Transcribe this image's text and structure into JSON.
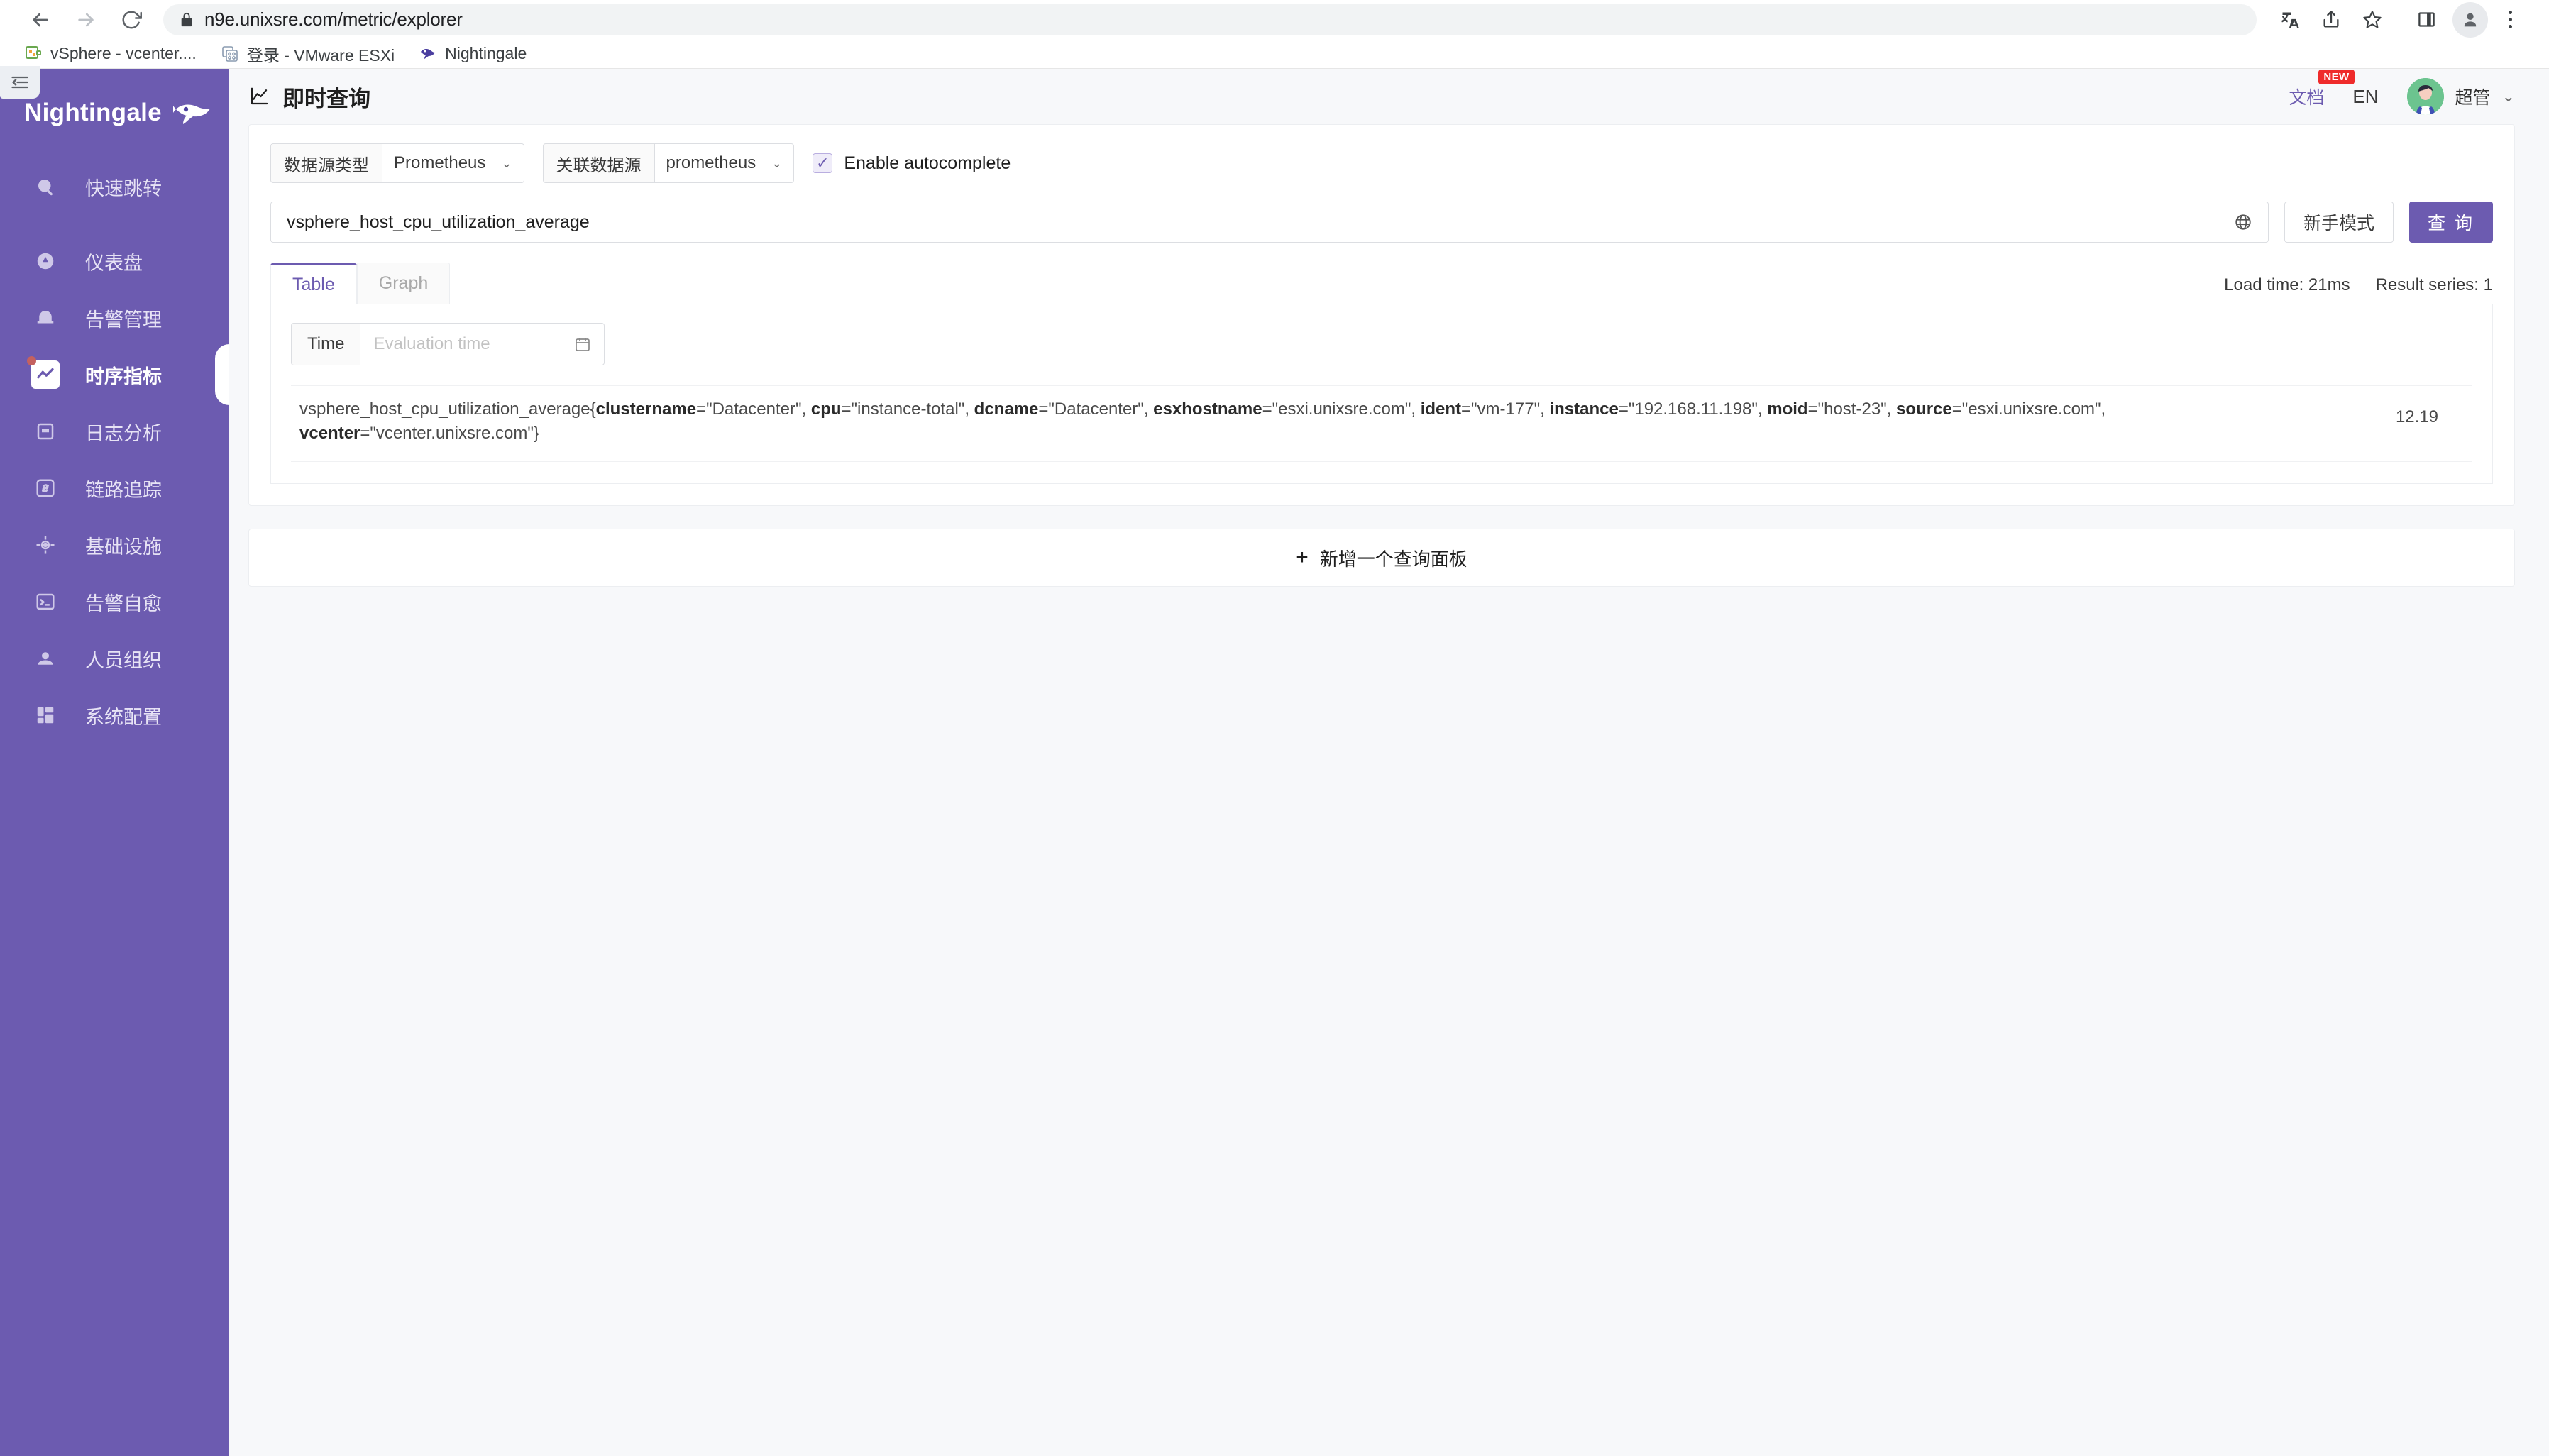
{
  "browser": {
    "url": "n9e.unixsre.com/metric/explorer",
    "nav": {
      "back": "back-arrow",
      "forward": "forward-arrow",
      "reload": "reload"
    },
    "lock_icon": "lock-icon",
    "bookmarks": [
      {
        "label": "vSphere - vcenter....",
        "icon": "vsphere-icon"
      },
      {
        "label": "登录 - VMware ESXi",
        "icon": "esxi-icon"
      },
      {
        "label": "Nightingale",
        "icon": "nightingale-icon"
      }
    ],
    "actions": [
      "translate-icon",
      "share-icon",
      "bookmark-star-icon",
      "side-panel-icon",
      "profile-icon",
      "more-menu-icon"
    ]
  },
  "sidebar": {
    "brand": "Nightingale",
    "collapse_icon": "collapse-sidebar-icon",
    "search_item": {
      "label": "快速跳转",
      "icon": "search-icon"
    },
    "items": [
      {
        "label": "仪表盘",
        "icon": "dashboard-icon",
        "active": false
      },
      {
        "label": "告警管理",
        "icon": "alert-bell-icon",
        "active": false
      },
      {
        "label": "时序指标",
        "icon": "metrics-chart-icon",
        "active": true
      },
      {
        "label": "日志分析",
        "icon": "log-analysis-icon",
        "active": false
      },
      {
        "label": "链路追踪",
        "icon": "trace-link-icon",
        "active": false
      },
      {
        "label": "基础设施",
        "icon": "infrastructure-icon",
        "active": false
      },
      {
        "label": "告警自愈",
        "icon": "terminal-icon",
        "active": false
      },
      {
        "label": "人员组织",
        "icon": "user-org-icon",
        "active": false
      },
      {
        "label": "系统配置",
        "icon": "system-settings-icon",
        "active": false
      }
    ]
  },
  "topbar": {
    "title": "即时查询",
    "title_icon": "line-chart-icon",
    "doc_label": "文档",
    "doc_badge": "NEW",
    "lang_label": "EN",
    "user_name": "超管",
    "caret_icon": "chevron-down-icon",
    "avatar_icon": "user-avatar"
  },
  "query_form": {
    "datasource_type": {
      "addon": "数据源类型",
      "value": "Prometheus"
    },
    "datasource": {
      "addon": "关联数据源",
      "value": "prometheus"
    },
    "autocomplete": {
      "label": "Enable autocomplete",
      "checked": "✓"
    },
    "promql": "vsphere_host_cpu_utilization_average",
    "globe_icon": "globe-icon",
    "beginner_mode_label": "新手模式",
    "query_button_label": "查 询"
  },
  "results": {
    "tabs": [
      {
        "label": "Table",
        "active": true
      },
      {
        "label": "Graph",
        "active": false
      }
    ],
    "load_time": "Load time: 21ms",
    "result_series": "Result series: 1",
    "time_addon": "Time",
    "time_placeholder": "Evaluation time",
    "calendar_icon": "calendar-icon",
    "rows": [
      {
        "metric": "vsphere_host_cpu_utilization_average",
        "open_brace": "{",
        "close_brace": "}",
        "labels": [
          {
            "name": "clustername",
            "value": "\"Datacenter\""
          },
          {
            "name": "cpu",
            "value": "\"instance-total\""
          },
          {
            "name": "dcname",
            "value": "\"Datacenter\""
          },
          {
            "name": "esxhostname",
            "value": "\"esxi.unixsre.com\""
          },
          {
            "name": "ident",
            "value": "\"vm-177\""
          },
          {
            "name": "instance",
            "value": "\"192.168.11.198\""
          },
          {
            "name": "moid",
            "value": "\"host-23\""
          },
          {
            "name": "source",
            "value": "\"esxi.unixsre.com\""
          },
          {
            "name": "vcenter",
            "value": "\"vcenter.unixsre.com\""
          }
        ],
        "value": "12.19"
      }
    ]
  },
  "add_panel": {
    "plus": "+",
    "label": "新增一个查询面板"
  },
  "colors": {
    "brand_purple": "#6C5BB0",
    "badge_red": "#ef2b2b",
    "avatar_green": "#6cc48f"
  }
}
